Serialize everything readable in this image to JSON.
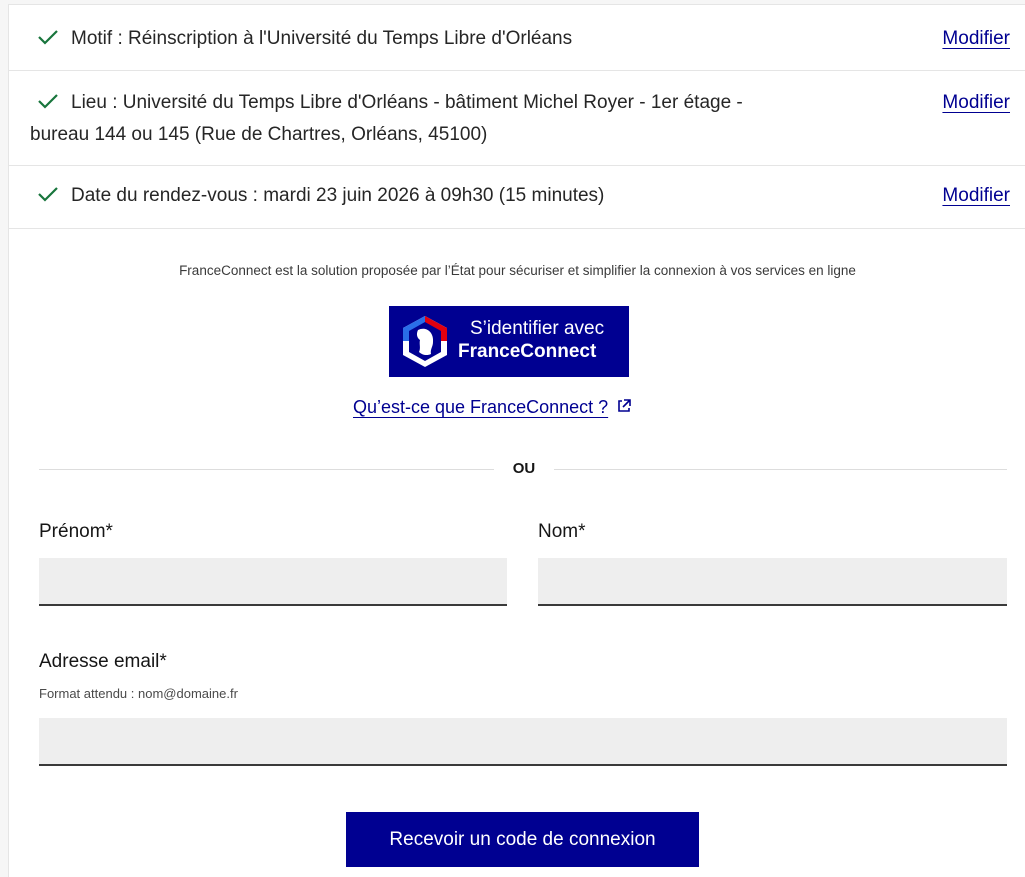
{
  "recap": [
    {
      "text": "Motif : Réinscription à l'Université du Temps Libre d'Orléans",
      "action": "Modifier"
    },
    {
      "text": "Lieu : Université du Temps Libre d'Orléans - bâtiment Michel Royer - 1er étage -",
      "text_cont": "bureau 144 ou 145 (Rue de Chartres, Orléans, 45100)",
      "action": "Modifier"
    },
    {
      "text": "Date du rendez-vous : mardi 23 juin 2026 à 09h30 (15 minutes)",
      "action": "Modifier"
    }
  ],
  "franceconnect": {
    "info": "FranceConnect est la solution proposée par l’État pour sécuriser et simplifier la connexion à vos services en ligne",
    "button_line1": "S’identifier avec",
    "button_line2": "FranceConnect",
    "link": "Qu’est-ce que FranceConnect ?"
  },
  "separator": "OU",
  "form": {
    "first_name_label": "Prénom*",
    "last_name_label": "Nom*",
    "email_label": "Adresse email*",
    "email_hint": "Format attendu : nom@domaine.fr",
    "submit_label": "Recevoir un code de connexion"
  },
  "colors": {
    "primary": "#000091",
    "check": "#18753c"
  }
}
